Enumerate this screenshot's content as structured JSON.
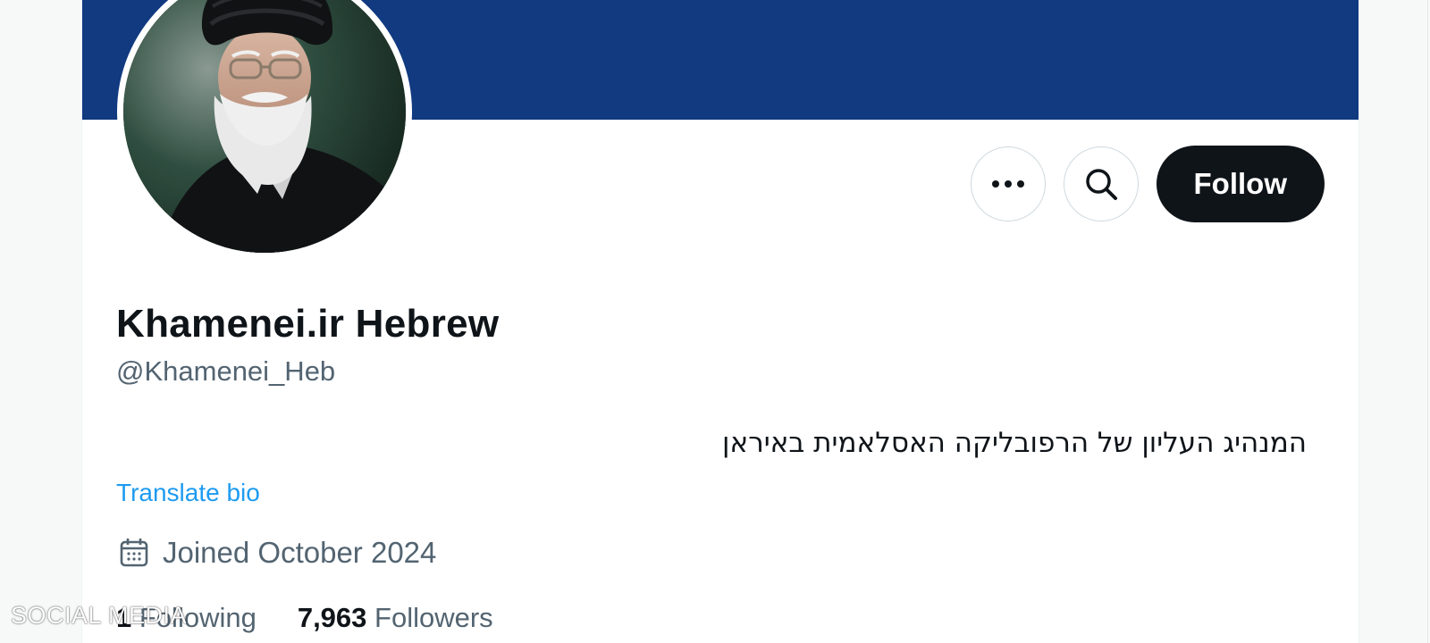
{
  "profile": {
    "display_name": "Khamenei.ir Hebrew",
    "handle": "@Khamenei_Heb",
    "bio": "המנהיג העליון של הרפובליקה האסלאמית באיראן",
    "translate_bio_label": "Translate bio",
    "joined": "Joined October 2024",
    "following_count": "1",
    "following_label": "Following",
    "followers_count": "7,963",
    "followers_label": "Followers",
    "avatar_icon": "profile-photo"
  },
  "actions": {
    "more_icon": "more-horizontal-icon",
    "search_icon": "search-icon",
    "follow_label": "Follow"
  },
  "watermark": {
    "text": "SOCIAL MEDIA"
  },
  "colors": {
    "banner": "#113a80",
    "follow_button": "#0f1419",
    "link": "#1d9bf0",
    "secondary_text": "#536471"
  }
}
